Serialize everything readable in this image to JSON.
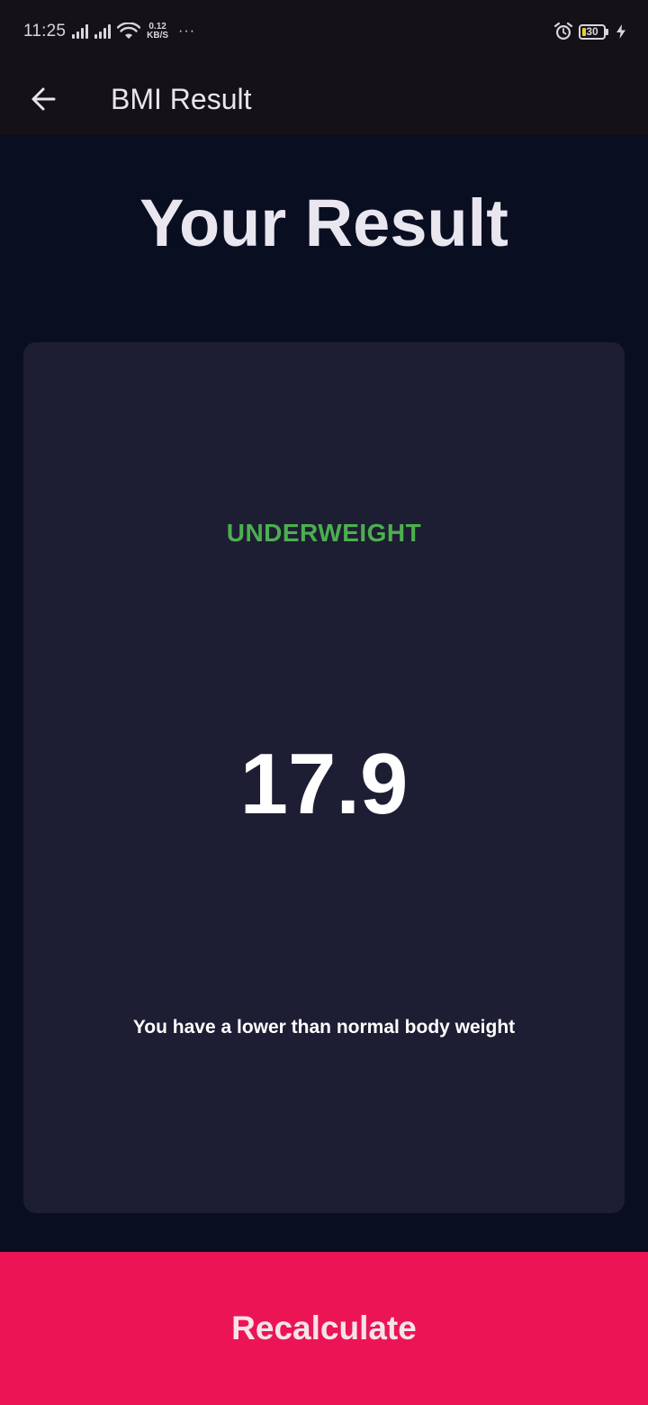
{
  "status_bar": {
    "time": "11:25",
    "net_speed_value": "0.12",
    "net_speed_unit": "KB/S",
    "more": "···",
    "battery_level": "30"
  },
  "app_bar": {
    "title": "BMI Result",
    "back_icon": "arrow-back-icon"
  },
  "headline": "Your Result",
  "result": {
    "status": "UNDERWEIGHT",
    "status_color": "#4caf50",
    "value": "17.9",
    "message": "You have a lower than normal body weight"
  },
  "recalculate_button": {
    "label": "Recalculate",
    "color": "#eb1555"
  },
  "colors": {
    "background": "#0a0e21",
    "card": "#1d1e33",
    "app_bar": "#141217"
  }
}
